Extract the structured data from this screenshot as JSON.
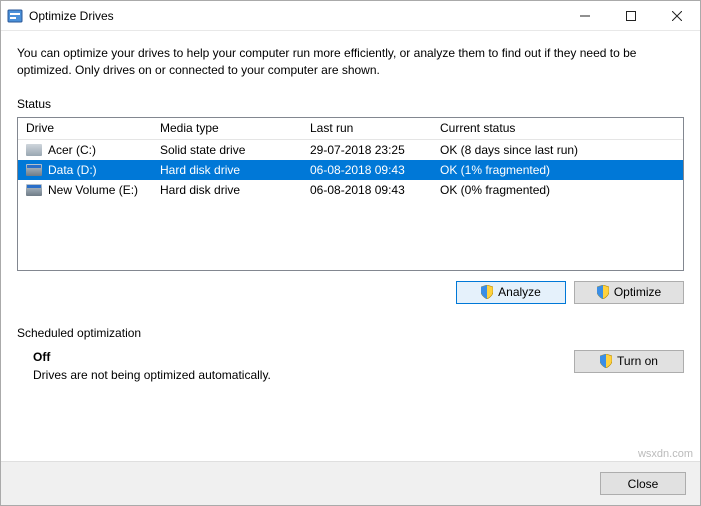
{
  "titlebar": {
    "title": "Optimize Drives"
  },
  "intro": "You can optimize your drives to help your computer run more efficiently, or analyze them to find out if they need to be optimized. Only drives on or connected to your computer are shown.",
  "status_label": "Status",
  "columns": {
    "drive": "Drive",
    "media": "Media type",
    "last": "Last run",
    "status": "Current status"
  },
  "rows": [
    {
      "icon": "ssd",
      "drive": "Acer (C:)",
      "media": "Solid state drive",
      "last": "29-07-2018 23:25",
      "status": "OK (8 days since last run)",
      "selected": false
    },
    {
      "icon": "hdd",
      "drive": "Data (D:)",
      "media": "Hard disk drive",
      "last": "06-08-2018 09:43",
      "status": "OK (1% fragmented)",
      "selected": true
    },
    {
      "icon": "hdd",
      "drive": "New Volume (E:)",
      "media": "Hard disk drive",
      "last": "06-08-2018 09:43",
      "status": "OK (0% fragmented)",
      "selected": false
    }
  ],
  "buttons": {
    "analyze": "Analyze",
    "optimize": "Optimize",
    "turnon": "Turn on",
    "close": "Close"
  },
  "scheduled": {
    "heading": "Scheduled optimization",
    "state": "Off",
    "desc": "Drives are not being optimized automatically."
  },
  "watermark": "wsxdn.com"
}
